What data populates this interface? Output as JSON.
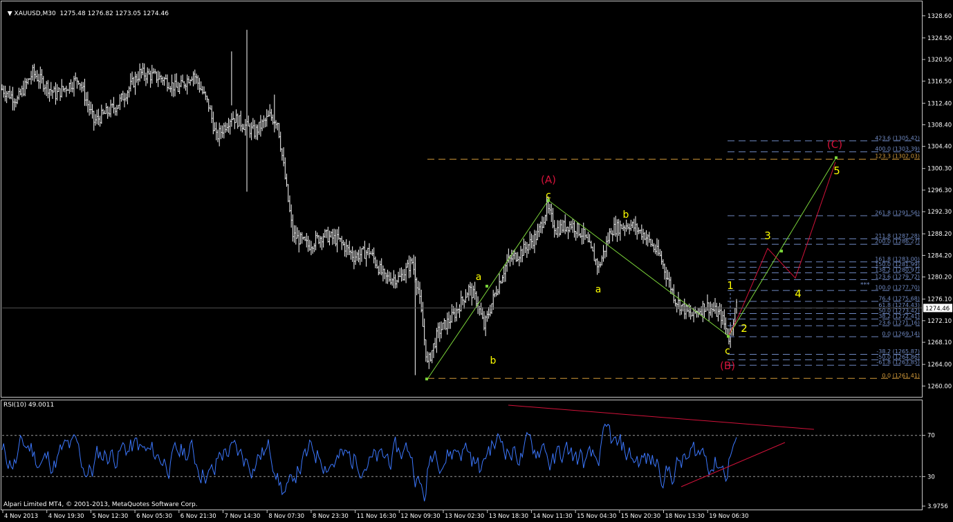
{
  "header": {
    "symbol": "XAUUSD,M30",
    "ohlc": "1275.48 1276.82 1273.05 1274.46",
    "rsi_label": "RSI(10) 49.0011",
    "copyright": "Alpari Limited MT4, © 2001-2013, MetaQuotes Software Corp."
  },
  "colors": {
    "background": "#000000",
    "bars": "#ffffff",
    "rsi": "#3c78ff",
    "fib": "#6f89c2",
    "orange": "#d39b3b",
    "wave_green": "#7cd63a",
    "wave_red": "#d3123a",
    "label_yellow": "#ffff00",
    "label_red": "#d3123a"
  },
  "chart_data": [
    {
      "type": "candlestick-bars",
      "name": "price",
      "last_price": "1274.46",
      "y_ticks": [
        "1328.60",
        "1324.50",
        "1320.50",
        "1316.50",
        "1312.40",
        "1308.40",
        "1304.40",
        "1300.30",
        "1296.30",
        "1292.30",
        "1288.20",
        "1284.20",
        "1280.20",
        "1276.10",
        "1272.10",
        "1268.10",
        "1264.00",
        "1260.00"
      ],
      "x_ticks": [
        "4 Nov 2013",
        "4 Nov 19:30",
        "5 Nov 12:30",
        "6 Nov 05:30",
        "6 Nov 21:30",
        "7 Nov 14:30",
        "8 Nov 07:30",
        "8 Nov 23:30",
        "11 Nov 16:30",
        "12 Nov 09:30",
        "13 Nov 02:30",
        "13 Nov 18:30",
        "14 Nov 11:30",
        "15 Nov 04:30",
        "15 Nov 20:30",
        "18 Nov 13:30",
        "19 Nov 06:30"
      ],
      "ylim": [
        1258.5,
        1330.5
      ],
      "price_path": [
        {
          "bar": 0,
          "price": 1315
        },
        {
          "bar": 10,
          "price": 1313
        },
        {
          "bar": 20,
          "price": 1318
        },
        {
          "bar": 35,
          "price": 1314
        },
        {
          "bar": 50,
          "price": 1317
        },
        {
          "bar": 60,
          "price": 1309
        },
        {
          "bar": 75,
          "price": 1312
        },
        {
          "bar": 90,
          "price": 1318
        },
        {
          "bar": 105,
          "price": 1317
        },
        {
          "bar": 115,
          "price": 1315
        },
        {
          "bar": 125,
          "price": 1318
        },
        {
          "bar": 135,
          "price": 1312
        },
        {
          "bar": 140,
          "price": 1306
        },
        {
          "bar": 150,
          "price": 1310
        },
        {
          "bar": 165,
          "price": 1307
        },
        {
          "bar": 175,
          "price": 1310
        },
        {
          "bar": 180,
          "price": 1309
        },
        {
          "bar": 190,
          "price": 1288
        },
        {
          "bar": 200,
          "price": 1286
        },
        {
          "bar": 210,
          "price": 1288
        },
        {
          "bar": 220,
          "price": 1287
        },
        {
          "bar": 230,
          "price": 1284
        },
        {
          "bar": 240,
          "price": 1285
        },
        {
          "bar": 250,
          "price": 1280
        },
        {
          "bar": 260,
          "price": 1280
        },
        {
          "bar": 268,
          "price": 1283
        },
        {
          "bar": 272,
          "price": 1278
        },
        {
          "bar": 278,
          "price": 1264
        },
        {
          "bar": 285,
          "price": 1270
        },
        {
          "bar": 295,
          "price": 1273
        },
        {
          "bar": 305,
          "price": 1278
        },
        {
          "bar": 310,
          "price": 1276
        },
        {
          "bar": 315,
          "price": 1271
        },
        {
          "bar": 322,
          "price": 1277
        },
        {
          "bar": 330,
          "price": 1283
        },
        {
          "bar": 340,
          "price": 1285
        },
        {
          "bar": 350,
          "price": 1288
        },
        {
          "bar": 356,
          "price": 1293
        },
        {
          "bar": 362,
          "price": 1289
        },
        {
          "bar": 372,
          "price": 1290
        },
        {
          "bar": 380,
          "price": 1288
        },
        {
          "bar": 390,
          "price": 1282
        },
        {
          "bar": 398,
          "price": 1289
        },
        {
          "bar": 410,
          "price": 1290
        },
        {
          "bar": 420,
          "price": 1288
        },
        {
          "bar": 430,
          "price": 1284
        },
        {
          "bar": 440,
          "price": 1276
        },
        {
          "bar": 450,
          "price": 1273
        },
        {
          "bar": 460,
          "price": 1275
        },
        {
          "bar": 470,
          "price": 1273
        },
        {
          "bar": 475,
          "price": 1269
        },
        {
          "bar": 480,
          "price": 1275
        }
      ],
      "fib_levels": [
        {
          "label": "423.6",
          "value": "1305.42",
          "p": 1305.42
        },
        {
          "label": "400.0",
          "value": "1303.39",
          "p": 1303.39
        },
        {
          "label": "123.3",
          "value": "1302.03",
          "p": 1302.03,
          "color": "orange"
        },
        {
          "label": "261.8",
          "value": "1291.56",
          "p": 1291.56
        },
        {
          "label": "211.8",
          "value": "1287.28",
          "p": 1287.28
        },
        {
          "label": "200.0",
          "value": "1286.27",
          "p": 1286.27
        },
        {
          "label": "161.8",
          "value": "1283.00",
          "p": 1283.0
        },
        {
          "label": "150.0",
          "value": "1281.99",
          "p": 1281.99
        },
        {
          "label": "138.2",
          "value": "1280.97",
          "p": 1280.97
        },
        {
          "label": "123.6",
          "value": "1279.72",
          "p": 1279.72
        },
        {
          "label": "100.0",
          "value": "1277.70",
          "p": 1277.7
        },
        {
          "label": "76.4",
          "value": "1275.68",
          "p": 1275.68
        },
        {
          "label": "61.8",
          "value": "1274.43",
          "p": 1274.43
        },
        {
          "label": "50.0",
          "value": "1273.42",
          "p": 1273.42
        },
        {
          "label": "38.2",
          "value": "1272.41",
          "p": 1272.41
        },
        {
          "label": "23.6",
          "value": "1271.16",
          "p": 1271.16
        },
        {
          "label": "0.0",
          "value": "1269.14",
          "p": 1269.14
        },
        {
          "label": "-38.2",
          "value": "1265.87",
          "p": 1265.87
        },
        {
          "label": "-50.0",
          "value": "1264.86",
          "p": 1264.86
        },
        {
          "label": "-61.8",
          "value": "1263.85",
          "p": 1263.85
        },
        {
          "label": "0.0",
          "value": "1261.41",
          "p": 1261.41,
          "color": "orange"
        }
      ],
      "fib_marker": "***",
      "wave_labels": [
        {
          "text": "(A)",
          "color": "red"
        },
        {
          "text": "c",
          "color": "yellow"
        },
        {
          "text": "a",
          "color": "yellow"
        },
        {
          "text": "b",
          "color": "yellow"
        },
        {
          "text": "b",
          "color": "yellow"
        },
        {
          "text": "a",
          "color": "yellow"
        },
        {
          "text": "1",
          "color": "yellow"
        },
        {
          "text": "2",
          "color": "yellow"
        },
        {
          "text": "3",
          "color": "yellow"
        },
        {
          "text": "4",
          "color": "yellow"
        },
        {
          "text": "5",
          "color": "yellow"
        },
        {
          "text": "c",
          "color": "white"
        },
        {
          "text": "(B)",
          "color": "red"
        },
        {
          "text": "(C)",
          "color": "red"
        }
      ]
    },
    {
      "type": "line",
      "name": "RSI(10)",
      "value": 49.0011,
      "y_ticks": [
        "70",
        "30",
        "3.9756"
      ],
      "levels": [
        70,
        30
      ]
    }
  ]
}
